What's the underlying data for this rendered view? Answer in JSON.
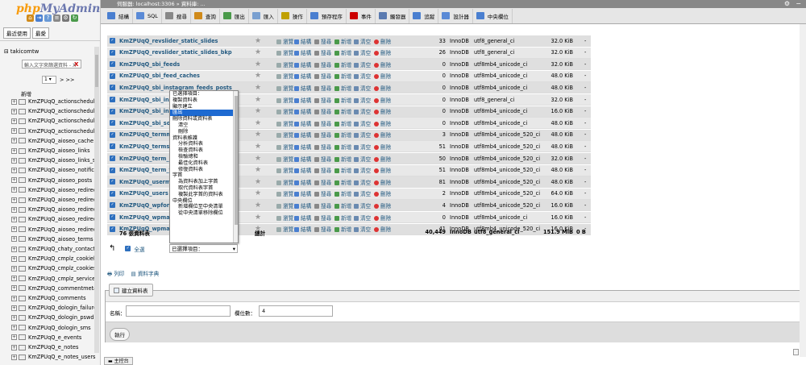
{
  "nav": {
    "logo_php": "php",
    "logo_admin": "MyAdmin",
    "tabs": [
      "最近使用",
      "最愛"
    ],
    "db": "takicomtw",
    "filter_placeholder": "輸入文字來篩選資料 - X",
    "filter_clear": "X",
    "page": "1",
    "next": "> >>",
    "new_label": "新增",
    "tables": [
      "KmZPUqQ_actionschedule",
      "KmZPUqQ_actionschedule",
      "KmZPUqQ_actionschedule",
      "KmZPUqQ_actionschedule",
      "KmZPUqQ_aioseo_cache",
      "KmZPUqQ_aioseo_links",
      "KmZPUqQ_aioseo_links_s",
      "KmZPUqQ_aioseo_notifica",
      "KmZPUqQ_aioseo_posts",
      "KmZPUqQ_aioseo_redirec",
      "KmZPUqQ_aioseo_redirec",
      "KmZPUqQ_aioseo_redirec",
      "KmZPUqQ_aioseo_redirec",
      "KmZPUqQ_aioseo_redirec",
      "KmZPUqQ_aioseo_terms",
      "KmZPUqQ_chaty_contact_",
      "KmZPUqQ_cmplz_cookieb",
      "KmZPUqQ_cmplz_cookies",
      "KmZPUqQ_cmplz_service",
      "KmZPUqQ_commentmeta",
      "KmZPUqQ_comments",
      "KmZPUqQ_dologin_failure",
      "KmZPUqQ_dologin_pswdl",
      "KmZPUqQ_dologin_sms",
      "KmZPUqQ_e_events",
      "KmZPUqQ_e_notes",
      "KmZPUqQ_e_notes_users"
    ]
  },
  "topbar": {
    "breadcrumb": "伺服器: localhost:3306 » 資料庫: ..."
  },
  "tabs": [
    "結構",
    "SQL",
    "搜尋",
    "查詢",
    "匯出",
    "匯入",
    "操作",
    "預存程序",
    "事件",
    "觸發器",
    "追蹤",
    "設計器",
    "中央欄位"
  ],
  "row_actions": [
    "瀏覽",
    "結構",
    "搜尋",
    "新增",
    "清空",
    "刪除"
  ],
  "rows": [
    {
      "name": "KmZPUqQ_revslider_static_slides",
      "rows": "33",
      "engine": "InnoDB",
      "collation": "utf8_general_ci",
      "size": "32.0 KiB",
      "overhead": "-"
    },
    {
      "name": "KmZPUqQ_revslider_static_slides_bkp",
      "rows": "26",
      "engine": "InnoDB",
      "collation": "utf8_general_ci",
      "size": "32.0 KiB",
      "overhead": "-"
    },
    {
      "name": "KmZPUqQ_sbi_feeds",
      "rows": "0",
      "engine": "InnoDB",
      "collation": "utf8mb4_unicode_ci",
      "size": "32.0 KiB",
      "overhead": "-"
    },
    {
      "name": "KmZPUqQ_sbi_feed_caches",
      "rows": "0",
      "engine": "InnoDB",
      "collation": "utf8mb4_unicode_ci",
      "size": "48.0 KiB",
      "overhead": "-"
    },
    {
      "name": "KmZPUqQ_sbi_instagram_feeds_posts",
      "rows": "0",
      "engine": "InnoDB",
      "collation": "utf8mb4_unicode_ci",
      "size": "48.0 KiB",
      "overhead": "-"
    },
    {
      "name": "KmZPUqQ_sbi_ins",
      "rows": "0",
      "engine": "InnoDB",
      "collation": "utf8_general_ci",
      "size": "32.0 KiB",
      "overhead": "-"
    },
    {
      "name": "KmZPUqQ_sbi_ins",
      "rows": "0",
      "engine": "InnoDB",
      "collation": "utf8mb4_unicode_ci",
      "size": "16.0 KiB",
      "overhead": "-"
    },
    {
      "name": "KmZPUqQ_sbi_so",
      "rows": "0",
      "engine": "InnoDB",
      "collation": "utf8mb4_unicode_ci",
      "size": "48.0 KiB",
      "overhead": "-"
    },
    {
      "name": "KmZPUqQ_termm",
      "rows": "3",
      "engine": "InnoDB",
      "collation": "utf8mb4_unicode_520_ci",
      "size": "48.0 KiB",
      "overhead": "-"
    },
    {
      "name": "KmZPUqQ_terms",
      "rows": "51",
      "engine": "InnoDB",
      "collation": "utf8mb4_unicode_520_ci",
      "size": "48.0 KiB",
      "overhead": "-"
    },
    {
      "name": "KmZPUqQ_term_r",
      "rows": "50",
      "engine": "InnoDB",
      "collation": "utf8mb4_unicode_520_ci",
      "size": "32.0 KiB",
      "overhead": "-"
    },
    {
      "name": "KmZPUqQ_term_t",
      "rows": "51",
      "engine": "InnoDB",
      "collation": "utf8mb4_unicode_520_ci",
      "size": "48.0 KiB",
      "overhead": "-"
    },
    {
      "name": "KmZPUqQ_userm",
      "rows": "81",
      "engine": "InnoDB",
      "collation": "utf8mb4_unicode_520_ci",
      "size": "48.0 KiB",
      "overhead": "-"
    },
    {
      "name": "KmZPUqQ_users",
      "rows": "2",
      "engine": "InnoDB",
      "collation": "utf8mb4_unicode_520_ci",
      "size": "64.0 KiB",
      "overhead": "-"
    },
    {
      "name": "KmZPUqQ_wpforn",
      "rows": "4",
      "engine": "InnoDB",
      "collation": "utf8mb4_unicode_520_ci",
      "size": "16.0 KiB",
      "overhead": "-"
    },
    {
      "name": "KmZPUqQ_wpmai",
      "rows": "0",
      "engine": "InnoDB",
      "collation": "utf8mb4_unicode_ci",
      "size": "16.0 KiB",
      "overhead": "-"
    },
    {
      "name": "KmZPUqQ_wpmai",
      "rows": "41",
      "engine": "InnoDB",
      "collation": "utf8mb4_unicode_520_ci",
      "size": "16.0 KiB",
      "overhead": "-"
    }
  ],
  "summary": {
    "count": "76 張資料表",
    "label": "總計",
    "rows": "40,449",
    "engine": "InnoDB",
    "collation": "utf8_general_ci",
    "size": "151.9 MiB",
    "overhead": "0 B"
  },
  "check_all_label": "全選",
  "with_selected": "已選擇項目：",
  "dropdown": [
    {
      "label": "已選擇項目：",
      "indent": false,
      "selected": false
    },
    {
      "label": "複製資料表",
      "indent": false,
      "selected": false
    },
    {
      "label": "顯示建立",
      "indent": false,
      "selected": false
    },
    {
      "label": "匯出",
      "indent": false,
      "selected": true
    },
    {
      "label": "刪除資料或資料表",
      "indent": false,
      "selected": false
    },
    {
      "label": "清空",
      "indent": true,
      "selected": false
    },
    {
      "label": "刪除",
      "indent": true,
      "selected": false
    },
    {
      "label": "資料表維護",
      "indent": false,
      "selected": false
    },
    {
      "label": "分析資料表",
      "indent": true,
      "selected": false
    },
    {
      "label": "檢查資料表",
      "indent": true,
      "selected": false
    },
    {
      "label": "檢驗總和",
      "indent": true,
      "selected": false
    },
    {
      "label": "最佳化資料表",
      "indent": true,
      "selected": false
    },
    {
      "label": "修復資料表",
      "indent": true,
      "selected": false
    },
    {
      "label": "字首",
      "indent": false,
      "selected": false
    },
    {
      "label": "為資料表加上字首",
      "indent": true,
      "selected": false
    },
    {
      "label": "取代資料表字首",
      "indent": true,
      "selected": false
    },
    {
      "label": "複製此字首的資料表",
      "indent": true,
      "selected": false
    },
    {
      "label": "中央欄位",
      "indent": false,
      "selected": false
    },
    {
      "label": "新增欄位至中央清單",
      "indent": true,
      "selected": false
    },
    {
      "label": "從中央清單移除欄位",
      "indent": true,
      "selected": false
    }
  ],
  "print_label": "列印",
  "dict_label": "資料字典",
  "create": {
    "button": "建立資料表",
    "name_label": "名稱：",
    "cols_label": "欄位數：",
    "cols_value": "4",
    "go": "執行"
  },
  "console_label": "主控台",
  "colors": {
    "accent": "#235a81",
    "selected": "#1e6ad1",
    "checkbox": "#2d6fbe"
  }
}
